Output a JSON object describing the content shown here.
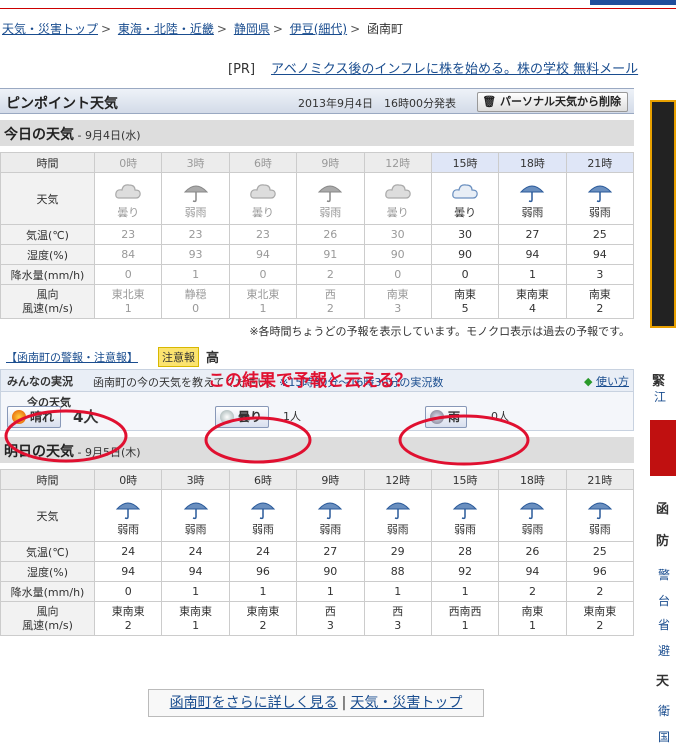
{
  "breadcrumb": {
    "items": [
      "天気・災害トップ",
      "東海・北陸・近畿",
      "静岡県",
      "伊豆(細代)"
    ],
    "current": "函南町"
  },
  "pr": {
    "tag": "[PR]",
    "text": "アベノミクス後のインフレに株を始める。株の学校 無料メール"
  },
  "header": {
    "title": "ピンポイント天気",
    "date": "2013年9月4日　16時00分発表",
    "delete_label": "パーソナル天気から削除"
  },
  "today": {
    "title": "今日の天気",
    "date": " - 9月4日(水)"
  },
  "tomorrow": {
    "title": "明日の天気",
    "date": " - 9月5日(木)"
  },
  "labels": {
    "time": "時間",
    "weather": "天気",
    "temp": "気温(℃)",
    "humidity": "湿度(%)",
    "precip": "降水量(mm/h)",
    "wind1": "風向",
    "wind2": "風速(m/s)"
  },
  "today_table": {
    "times": [
      "0時",
      "3時",
      "6時",
      "9時",
      "12時",
      "15時",
      "18時",
      "21時"
    ],
    "icons": [
      "cloud-icon",
      "umbrella-icon",
      "cloud-icon",
      "umbrella-icon",
      "cloud-icon",
      "cloud-icon",
      "umbrella-icon",
      "umbrella-icon"
    ],
    "weather": [
      "曇り",
      "弱雨",
      "曇り",
      "弱雨",
      "曇り",
      "曇り",
      "弱雨",
      "弱雨"
    ],
    "temp": [
      "23",
      "23",
      "23",
      "26",
      "30",
      "30",
      "27",
      "25"
    ],
    "humidity": [
      "84",
      "93",
      "94",
      "91",
      "90",
      "90",
      "94",
      "94"
    ],
    "precip": [
      "0",
      "1",
      "0",
      "2",
      "0",
      "0",
      "1",
      "3"
    ],
    "wind_dir": [
      "東北東",
      "静穏",
      "東北東",
      "西",
      "南東",
      "南東",
      "東南東",
      "南東"
    ],
    "wind_speed": [
      "1",
      "0",
      "1",
      "2",
      "3",
      "5",
      "4",
      "2"
    ]
  },
  "tomorrow_table": {
    "times": [
      "0時",
      "3時",
      "6時",
      "9時",
      "12時",
      "15時",
      "18時",
      "21時"
    ],
    "icons": [
      "umbrella-icon",
      "umbrella-icon",
      "umbrella-icon",
      "umbrella-icon",
      "umbrella-icon",
      "umbrella-icon",
      "umbrella-icon",
      "umbrella-icon"
    ],
    "weather": [
      "弱雨",
      "弱雨",
      "弱雨",
      "弱雨",
      "弱雨",
      "弱雨",
      "弱雨",
      "弱雨"
    ],
    "temp": [
      "24",
      "24",
      "24",
      "27",
      "29",
      "28",
      "26",
      "25"
    ],
    "humidity": [
      "94",
      "94",
      "96",
      "90",
      "88",
      "92",
      "94",
      "96"
    ],
    "precip": [
      "0",
      "1",
      "1",
      "1",
      "1",
      "1",
      "2",
      "2"
    ],
    "wind_dir": [
      "東南東",
      "東南東",
      "東南東",
      "西",
      "西",
      "西南西",
      "南東",
      "東南東"
    ],
    "wind_speed": [
      "2",
      "1",
      "2",
      "3",
      "3",
      "1",
      "1",
      "2"
    ]
  },
  "note": "※各時間ちょうどの予報を表示しています。モノクロ表示は過去の予報です。",
  "alert": {
    "link": "【函南町の警報・注意報】",
    "badge": "注意報",
    "badge2": "高"
  },
  "annotation": "この結果で予報と云える？",
  "minna": {
    "label": "みんなの実況",
    "sub": "今の天気",
    "question": "函南町の今の天気を教えてください。",
    "range": "※15時30分〜16時30分の実況数",
    "guide": "使い方",
    "sunny": "晴れ",
    "sunny_count": "4人",
    "cloudy": "曇り",
    "cloudy_count": "1人",
    "rain": "雨",
    "rain_count": "0人"
  },
  "more": {
    "link1": "函南町をさらに詳しく見る",
    "sep": "|",
    "link2": "天気・災害トップ"
  },
  "side": [
    "緊",
    "江",
    "函",
    "防",
    "警",
    "台",
    "省",
    "避",
    "天",
    "衛",
    "国"
  ],
  "colors": {
    "accent": "#1a4d8f",
    "highlight": "#dfe6f7",
    "annotation": "#e01030"
  }
}
